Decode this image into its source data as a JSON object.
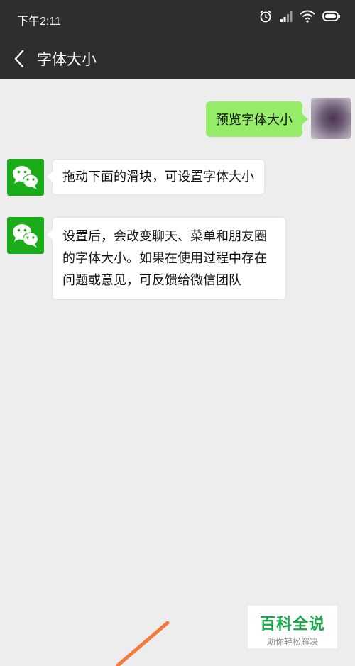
{
  "status_bar": {
    "time": "下午2:11",
    "icons": [
      "alarm-icon",
      "signal-icon",
      "wifi-icon",
      "battery-icon"
    ]
  },
  "nav": {
    "back_icon": "chevron-left-icon",
    "title": "字体大小"
  },
  "messages": [
    {
      "sender": "self",
      "text": "预览字体大小"
    },
    {
      "sender": "wechat",
      "text": "拖动下面的滑块，可设置字体大小"
    },
    {
      "sender": "wechat",
      "text": "设置后，会改变聊天、菜单和朋友圈的字体大小。如果在使用过程中存在问题或意见，可反馈给微信团队"
    }
  ],
  "watermark": {
    "title": "百科全说",
    "subtitle": "助你轻松解决"
  },
  "colors": {
    "header_bg": "#2e2e2e",
    "chat_bg": "#ededed",
    "self_bubble": "#95ec69",
    "wechat_green": "#1aad19",
    "watermark_text": "#18a84a",
    "arrow": "#f47a3c"
  }
}
